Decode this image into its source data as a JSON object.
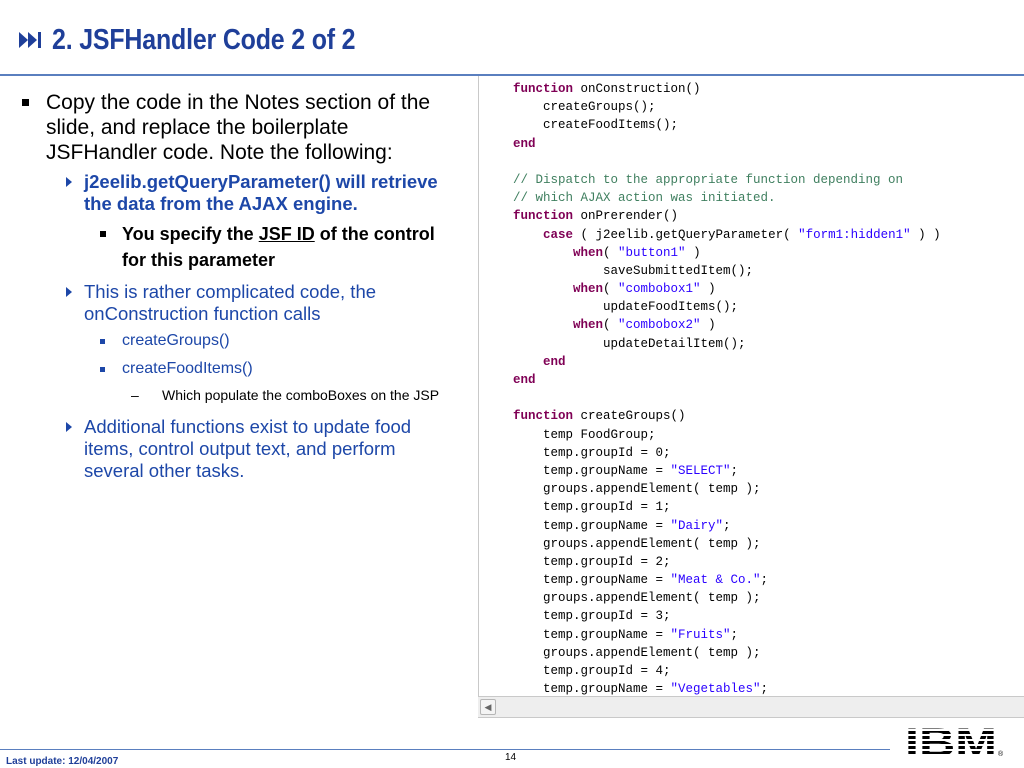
{
  "title": "2. JSFHandler Code 2 of 2",
  "title_icon": "next-slide-icon",
  "colors": {
    "title": "#1f3f99",
    "accent": "#1d47a8",
    "rule": "#5a7fbf"
  },
  "bullets": {
    "l1_intro": "Copy the code in the Notes section of the slide, and replace the boilerplate JSFHandler code.  Note the following:",
    "l2_query": "j2eelib.getQueryParameter() will retrieve the data from the AJAX engine.",
    "l3_specify_pre": "You specify the ",
    "l3_specify_link": "JSF ID",
    "l3_specify_post": " of the control for this parameter",
    "l2_complicated": "This is rather complicated code, the onConstruction function calls",
    "l3_groups": "createGroups()",
    "l3_fooditems": "createFoodItems()",
    "l4_marker": "–",
    "l4_populate": "Which populate the comboBoxes on the JSP",
    "l2_additional": "Additional functions exist to update food items, control output text, and perform several other tasks."
  },
  "code_lines": [
    [
      {
        "t": "kw",
        "v": "function"
      },
      {
        "t": "n",
        "v": " onConstruction()"
      }
    ],
    [
      {
        "t": "n",
        "v": "    createGroups();"
      }
    ],
    [
      {
        "t": "n",
        "v": "    createFoodItems();"
      }
    ],
    [
      {
        "t": "kw",
        "v": "end"
      }
    ],
    [],
    [
      {
        "t": "cm",
        "v": "// Dispatch to the appropriate function depending on"
      }
    ],
    [
      {
        "t": "cm",
        "v": "// which AJAX action was initiated."
      }
    ],
    [
      {
        "t": "kw",
        "v": "function"
      },
      {
        "t": "n",
        "v": " onPrerender()"
      }
    ],
    [
      {
        "t": "n",
        "v": "    "
      },
      {
        "t": "kw",
        "v": "case"
      },
      {
        "t": "n",
        "v": " ( j2eelib.getQueryParameter( "
      },
      {
        "t": "st",
        "v": "\"form1:hidden1\""
      },
      {
        "t": "n",
        "v": " ) )"
      }
    ],
    [
      {
        "t": "n",
        "v": "        "
      },
      {
        "t": "kw",
        "v": "when"
      },
      {
        "t": "n",
        "v": "( "
      },
      {
        "t": "st",
        "v": "\"button1\""
      },
      {
        "t": "n",
        "v": " )"
      }
    ],
    [
      {
        "t": "n",
        "v": "            saveSubmittedItem();"
      }
    ],
    [
      {
        "t": "n",
        "v": "        "
      },
      {
        "t": "kw",
        "v": "when"
      },
      {
        "t": "n",
        "v": "( "
      },
      {
        "t": "st",
        "v": "\"combobox1\""
      },
      {
        "t": "n",
        "v": " )"
      }
    ],
    [
      {
        "t": "n",
        "v": "            updateFoodItems();"
      }
    ],
    [
      {
        "t": "n",
        "v": "        "
      },
      {
        "t": "kw",
        "v": "when"
      },
      {
        "t": "n",
        "v": "( "
      },
      {
        "t": "st",
        "v": "\"combobox2\""
      },
      {
        "t": "n",
        "v": " )"
      }
    ],
    [
      {
        "t": "n",
        "v": "            updateDetailItem();"
      }
    ],
    [
      {
        "t": "n",
        "v": "    "
      },
      {
        "t": "kw",
        "v": "end"
      }
    ],
    [
      {
        "t": "kw",
        "v": "end"
      }
    ],
    [],
    [
      {
        "t": "kw",
        "v": "function"
      },
      {
        "t": "n",
        "v": " createGroups()"
      }
    ],
    [
      {
        "t": "n",
        "v": "    temp FoodGroup;"
      }
    ],
    [
      {
        "t": "n",
        "v": "    temp.groupId = 0;"
      }
    ],
    [
      {
        "t": "n",
        "v": "    temp.groupName = "
      },
      {
        "t": "st",
        "v": "\"SELECT\""
      },
      {
        "t": "n",
        "v": ";"
      }
    ],
    [
      {
        "t": "n",
        "v": "    groups.appendElement( temp );"
      }
    ],
    [
      {
        "t": "n",
        "v": "    temp.groupId = 1;"
      }
    ],
    [
      {
        "t": "n",
        "v": "    temp.groupName = "
      },
      {
        "t": "st",
        "v": "\"Dairy\""
      },
      {
        "t": "n",
        "v": ";"
      }
    ],
    [
      {
        "t": "n",
        "v": "    groups.appendElement( temp );"
      }
    ],
    [
      {
        "t": "n",
        "v": "    temp.groupId = 2;"
      }
    ],
    [
      {
        "t": "n",
        "v": "    temp.groupName = "
      },
      {
        "t": "st",
        "v": "\"Meat & Co.\""
      },
      {
        "t": "n",
        "v": ";"
      }
    ],
    [
      {
        "t": "n",
        "v": "    groups.appendElement( temp );"
      }
    ],
    [
      {
        "t": "n",
        "v": "    temp.groupId = 3;"
      }
    ],
    [
      {
        "t": "n",
        "v": "    temp.groupName = "
      },
      {
        "t": "st",
        "v": "\"Fruits\""
      },
      {
        "t": "n",
        "v": ";"
      }
    ],
    [
      {
        "t": "n",
        "v": "    groups.appendElement( temp );"
      }
    ],
    [
      {
        "t": "n",
        "v": "    temp.groupId = 4;"
      }
    ],
    [
      {
        "t": "n",
        "v": "    temp.groupName = "
      },
      {
        "t": "st",
        "v": "\"Vegetables\""
      },
      {
        "t": "n",
        "v": ";"
      }
    ]
  ],
  "footer": {
    "last_update": "Last update: 12/04/2007",
    "page_number": "14"
  },
  "logo": {
    "name": "ibm-logo",
    "text": "IBM",
    "mark": "®"
  }
}
